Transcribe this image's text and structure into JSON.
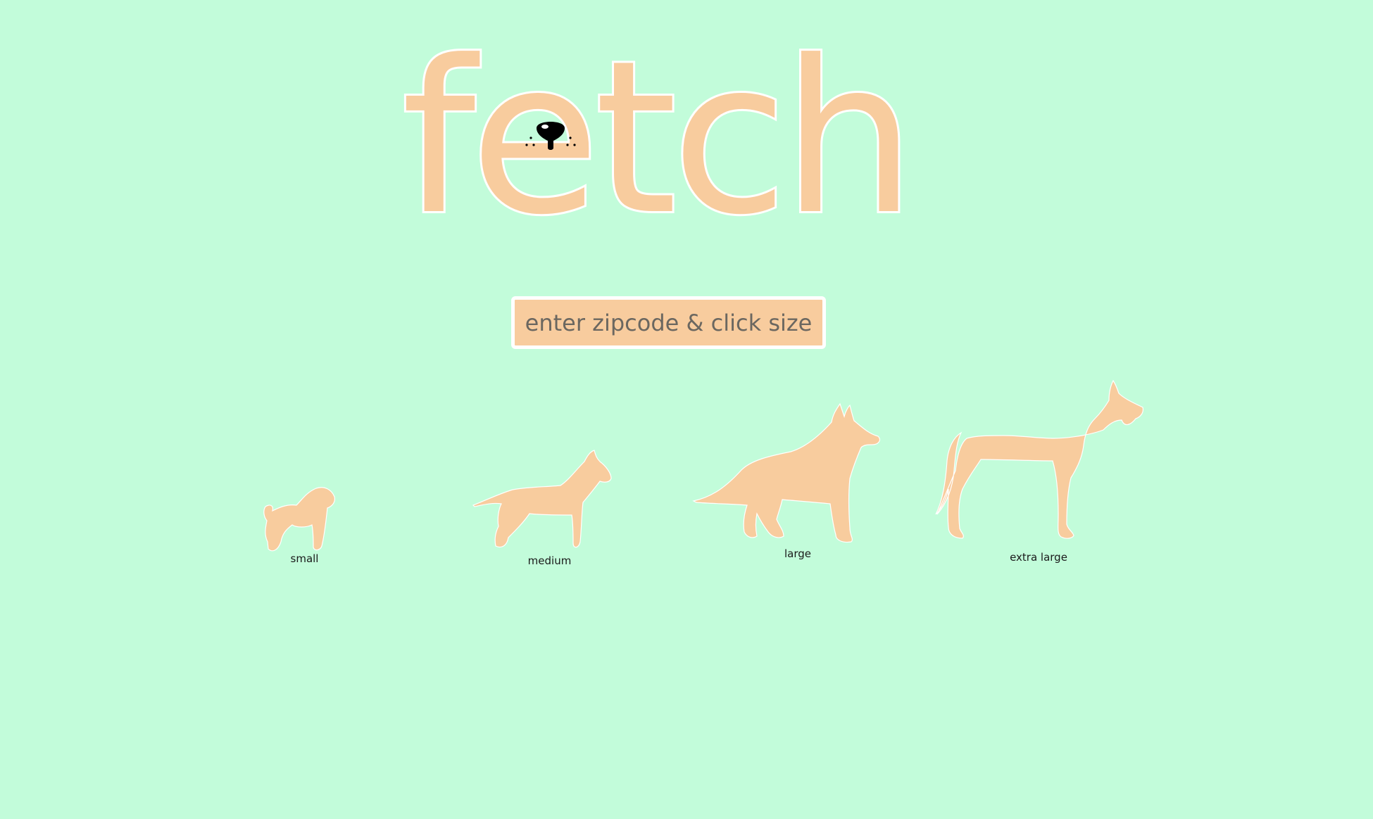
{
  "app": {
    "logo_text": "fetch"
  },
  "search": {
    "placeholder": "enter zipcode & click size"
  },
  "sizes": [
    {
      "label": "small",
      "icon": "small-dog-icon"
    },
    {
      "label": "medium",
      "icon": "medium-dog-icon"
    },
    {
      "label": "large",
      "icon": "large-dog-icon"
    },
    {
      "label": "extra large",
      "icon": "extra-large-dog-icon"
    }
  ],
  "colors": {
    "background": "#c2fcda",
    "accent": "#f8cc9e",
    "outline": "#ffffff",
    "text": "#6b6760"
  }
}
